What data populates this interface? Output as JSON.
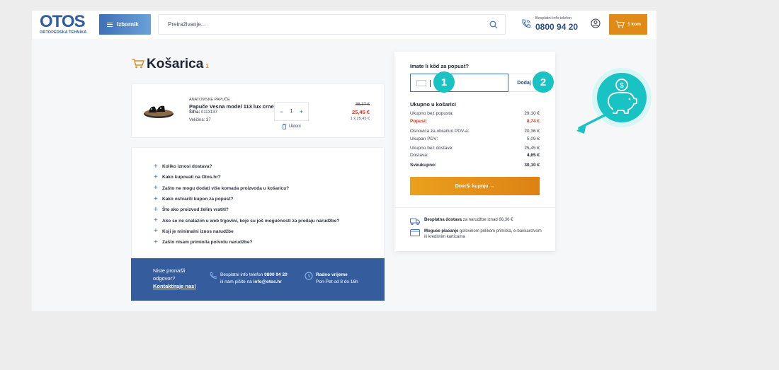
{
  "header": {
    "logo_main": "OTOS",
    "logo_sub": "ORTOPEDSKA TEHNIKA",
    "menu_label": "Izbornik",
    "search_placeholder": "Pretraživanje...",
    "phone_label": "Besplatni info telefon",
    "phone_number": "0800 94 20",
    "cart_label": "1 kom"
  },
  "cart": {
    "title": "Košarica",
    "count": "1"
  },
  "product": {
    "category": "ANATOMSKE PAPUČE",
    "name": "Papuče Vesna model 113 lux crne",
    "sku_label": "Šifra:",
    "sku_value": "0113137",
    "size": "Veličina: 37",
    "quantity": "1",
    "minus": "−",
    "plus": "+",
    "remove_label": "Ukloni",
    "price_old": "36,37 €",
    "price_new": "25,45 €",
    "price_unit": "1 x 25,45 €"
  },
  "faq": [
    "Koliko iznosi dostava?",
    "Kako kupovati na Otos.hr?",
    "Zašto ne mogu dodati više komada proizvoda u košaricu?",
    "Kako ostvariti kupon za popust?",
    "Što ako proizvod želim vratiti?",
    "Ako se ne snalazim u web trgovini, koje su još mogućnosti za predaju narudžbe?",
    "Koji je minimalni iznos narudžbe",
    "Zašto nisam primio/la potvrdu narudžbe?"
  ],
  "faq_plus": "+",
  "contact": {
    "question_line1": "Niste pronašli",
    "question_line2": "odgovor?",
    "contact_link": "Kontaktiraje nas!",
    "phone_text": "Besplatni info telefon",
    "phone_number": "0800 94 20",
    "email_text": "ili nam pišite na",
    "email": "info@otos.hr",
    "hours_title": "Radno vrijeme",
    "hours_value": "Pon-Pet od 8 do 16h"
  },
  "summary": {
    "coupon_title": "Imate li kôd za popust?",
    "coupon_add": "Dodaj",
    "badge_1": "1",
    "badge_2": "2",
    "heading": "Ukupno u košarici",
    "rows": [
      {
        "label": "Ukupno bez popusta:",
        "value": "29,10 €"
      },
      {
        "label": "Popust:",
        "value": "8,74 €"
      },
      {
        "label": "Osnovica za obračun PDV-a:",
        "value": "20,36 €"
      },
      {
        "label": "Ukupan PDV:",
        "value": "5,09 €"
      },
      {
        "label": "Ukupno bez dostave:",
        "value": "25,45 €"
      },
      {
        "label": "Dostava:",
        "value": "4,65 €"
      },
      {
        "label": "Sveukupno:",
        "value": "30,10 €"
      }
    ],
    "checkout_label": "Dovrši kupnju →",
    "info_delivery_bold": "Besplatna dostava",
    "info_delivery_rest": "za narudžbe iznad 66,36 €",
    "info_payment_bold": "Moguće plaćanje",
    "info_payment_rest": "gotovinom prilikom primitka, e-bankarstvom ili kreditnim karticama"
  },
  "colors": {
    "brand_blue": "#2e5da6",
    "accent_orange": "#e08a1a",
    "discount_red": "#d2391d",
    "highlight_teal": "#19c3c3"
  }
}
